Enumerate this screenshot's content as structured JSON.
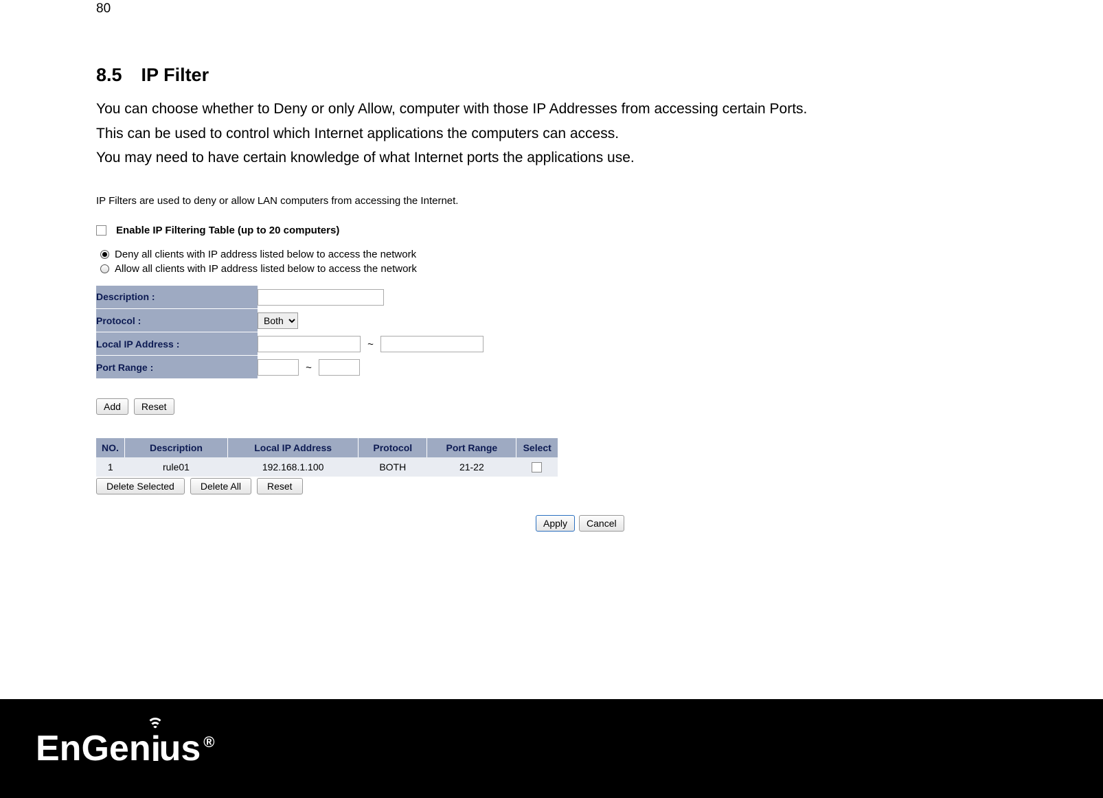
{
  "page_number": "80",
  "section": {
    "num": "8.5",
    "title": "IP Filter"
  },
  "paragraphs": [
    "You can choose whether to Deny or only Allow, computer with those IP Addresses from accessing certain Ports.",
    "This can be used to control which Internet applications the computers can access.",
    "You may need to have certain knowledge of what Internet ports the applications use."
  ],
  "ui": {
    "intro": "IP Filters are used to deny or allow LAN computers from accessing the Internet.",
    "enable_label": "Enable IP Filtering Table (up to 20 computers)",
    "enable_checked": false,
    "radios": {
      "deny": "Deny all clients with IP address listed below to access the network",
      "allow": "Allow all clients with IP address listed below to access the network",
      "selected": "deny"
    },
    "form": {
      "description_label": "Description :",
      "description_value": "",
      "protocol_label": "Protocol :",
      "protocol_value": "Both",
      "localip_label": "Local IP Address :",
      "localip_from": "",
      "localip_to": "",
      "portrange_label": "Port Range :",
      "port_from": "",
      "port_to": ""
    },
    "buttons": {
      "add": "Add",
      "reset": "Reset"
    },
    "table": {
      "headers": {
        "no": "NO.",
        "desc": "Description",
        "ip": "Local IP Address",
        "proto": "Protocol",
        "port": "Port Range",
        "sel": "Select"
      },
      "rows": [
        {
          "no": "1",
          "desc": "rule01",
          "ip": "192.168.1.100",
          "proto": "BOTH",
          "port": "21-22",
          "selected": false
        }
      ],
      "btns": {
        "del_sel": "Delete Selected",
        "del_all": "Delete All",
        "reset": "Reset"
      }
    },
    "footer_btns": {
      "apply": "Apply",
      "cancel": "Cancel"
    }
  },
  "logo": {
    "pre": "EnGen",
    "post": "us"
  }
}
